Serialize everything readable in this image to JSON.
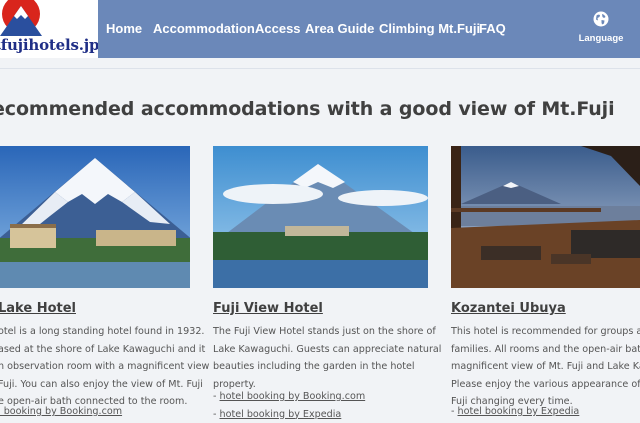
{
  "logo": {
    "text": "tfujihotels.jp"
  },
  "nav": {
    "items": [
      "Home",
      "Accommodation",
      "Access",
      "Area Guide",
      "Climbing Mt.Fuji",
      "FAQ"
    ],
    "language_label": "Language"
  },
  "page_title": "ecommended accommodations with a good view of Mt.Fuji",
  "hotels": [
    {
      "name": "Lake Hotel",
      "description": [
        "otel is a long standing hotel found in 1932.",
        "ased at the shore of Lake Kawaguchi and it",
        "n observation room with a magnificent view",
        "Fuji. You can also enjoy the view of Mt. Fuji",
        "e open-air bath connected to the room."
      ],
      "links": [
        "l booking by Booking.com"
      ]
    },
    {
      "name": "Fuji View Hotel",
      "description": [
        "The Fuji View Hotel stands just on the shore of",
        "Lake Kawaguchi. Guests can appreciate natural",
        "beauties including the garden in the hotel",
        "property."
      ],
      "links": [
        "hotel booking by Booking.com",
        "hotel booking by Expedia"
      ]
    },
    {
      "name": "Kozantei Ubuya",
      "description": [
        "This hotel is recommended for groups and",
        "families. All rooms and the open-air bath ha",
        "magnificent view of Mt. Fuji and Lake Kawag",
        "Please enjoy the various appearance of the",
        "Fuji changing every time."
      ],
      "links": [
        "hotel booking by Expedia"
      ]
    }
  ],
  "colors": {
    "header": "#6b88b9",
    "background": "#f1f3f6",
    "logo_text": "#1f2e86",
    "logo_red": "#d9251c"
  },
  "icons": [
    "globe-icon"
  ]
}
